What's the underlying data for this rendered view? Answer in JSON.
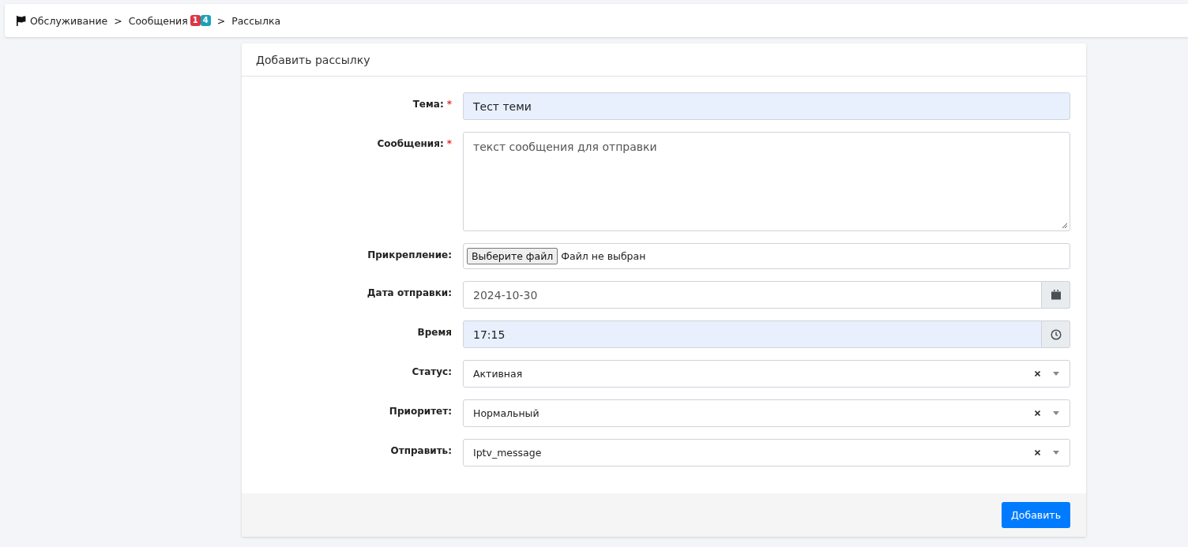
{
  "breadcrumb": [
    {
      "label": "Обслуживание"
    },
    {
      "label": "Сообщения",
      "badges": [
        {
          "text": "1",
          "color": "#dc3545"
        },
        {
          "text": "4",
          "color": "#17a2b8"
        }
      ]
    },
    {
      "label": "Рассылка"
    }
  ],
  "breadcrumb_separator": ">",
  "card": {
    "title": "Добавить рассылку",
    "fields": [
      {
        "kind": "text",
        "label": "Тема:",
        "required_mark": "*",
        "autofilled": true,
        "value": "Тест теми"
      },
      {
        "kind": "textarea",
        "label": "Сообщения:",
        "required_mark": "*",
        "autofilled": false,
        "value": "текст сообщения для отправки"
      },
      {
        "kind": "file",
        "label": "Прикрепление:",
        "autofilled": false,
        "button": "Выберите файл",
        "value": "Файл не выбран"
      },
      {
        "kind": "date",
        "label": "Дата отправки:",
        "autofilled": false,
        "value": "2024-10-30"
      },
      {
        "kind": "time",
        "label": "Время",
        "autofilled": true,
        "value": "17:15"
      },
      {
        "kind": "select",
        "label": "Статус:",
        "autofilled": false,
        "value": "Активная"
      },
      {
        "kind": "select",
        "label": "Приоритет:",
        "autofilled": false,
        "value": "Нормальный"
      },
      {
        "kind": "select",
        "label": "Отправить:",
        "autofilled": false,
        "value": "Iptv_message"
      }
    ],
    "submit": "Добавить"
  }
}
